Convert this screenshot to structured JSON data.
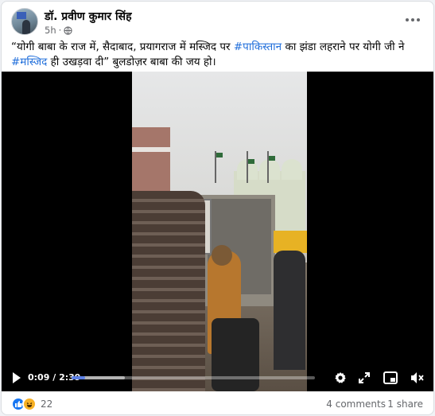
{
  "post": {
    "author": "डॉ. प्रवीण कुमार सिंह",
    "time": "5h",
    "visibility_separator": "·",
    "text_parts": {
      "part1": "“योगी बाबा के राज में, सैदाबाद, प्रयागराज में मस्जिद पर ",
      "hashtag1": "#पाकिस्तान",
      "part2": " का झंडा लहराने पर योगी जी ने ",
      "hashtag2": "#मस्जिद",
      "part3": " ही उखड़वा दी” बुलडोज़र बाबा की जय हो।"
    }
  },
  "video": {
    "current_time": "0:09",
    "duration": "2:39",
    "time_separator": " / ",
    "progress": 0.057,
    "buffered": 0.22
  },
  "footer": {
    "reaction_count": "22",
    "comments_label": "4 comments",
    "shares_label": "1 share"
  },
  "icons": {
    "more": "more-options-icon",
    "globe": "globe-icon",
    "play": "play-icon",
    "settings": "gear-icon",
    "fullscreen": "fullscreen-icon",
    "pip": "picture-in-picture-icon",
    "volume": "volume-muted-icon",
    "like": "like-reaction-icon",
    "haha": "haha-reaction-icon"
  },
  "colors": {
    "hashtag": "#216fdb",
    "progress": "#5b7fe6",
    "like": "#1877f2",
    "haha": "#f7b125"
  }
}
